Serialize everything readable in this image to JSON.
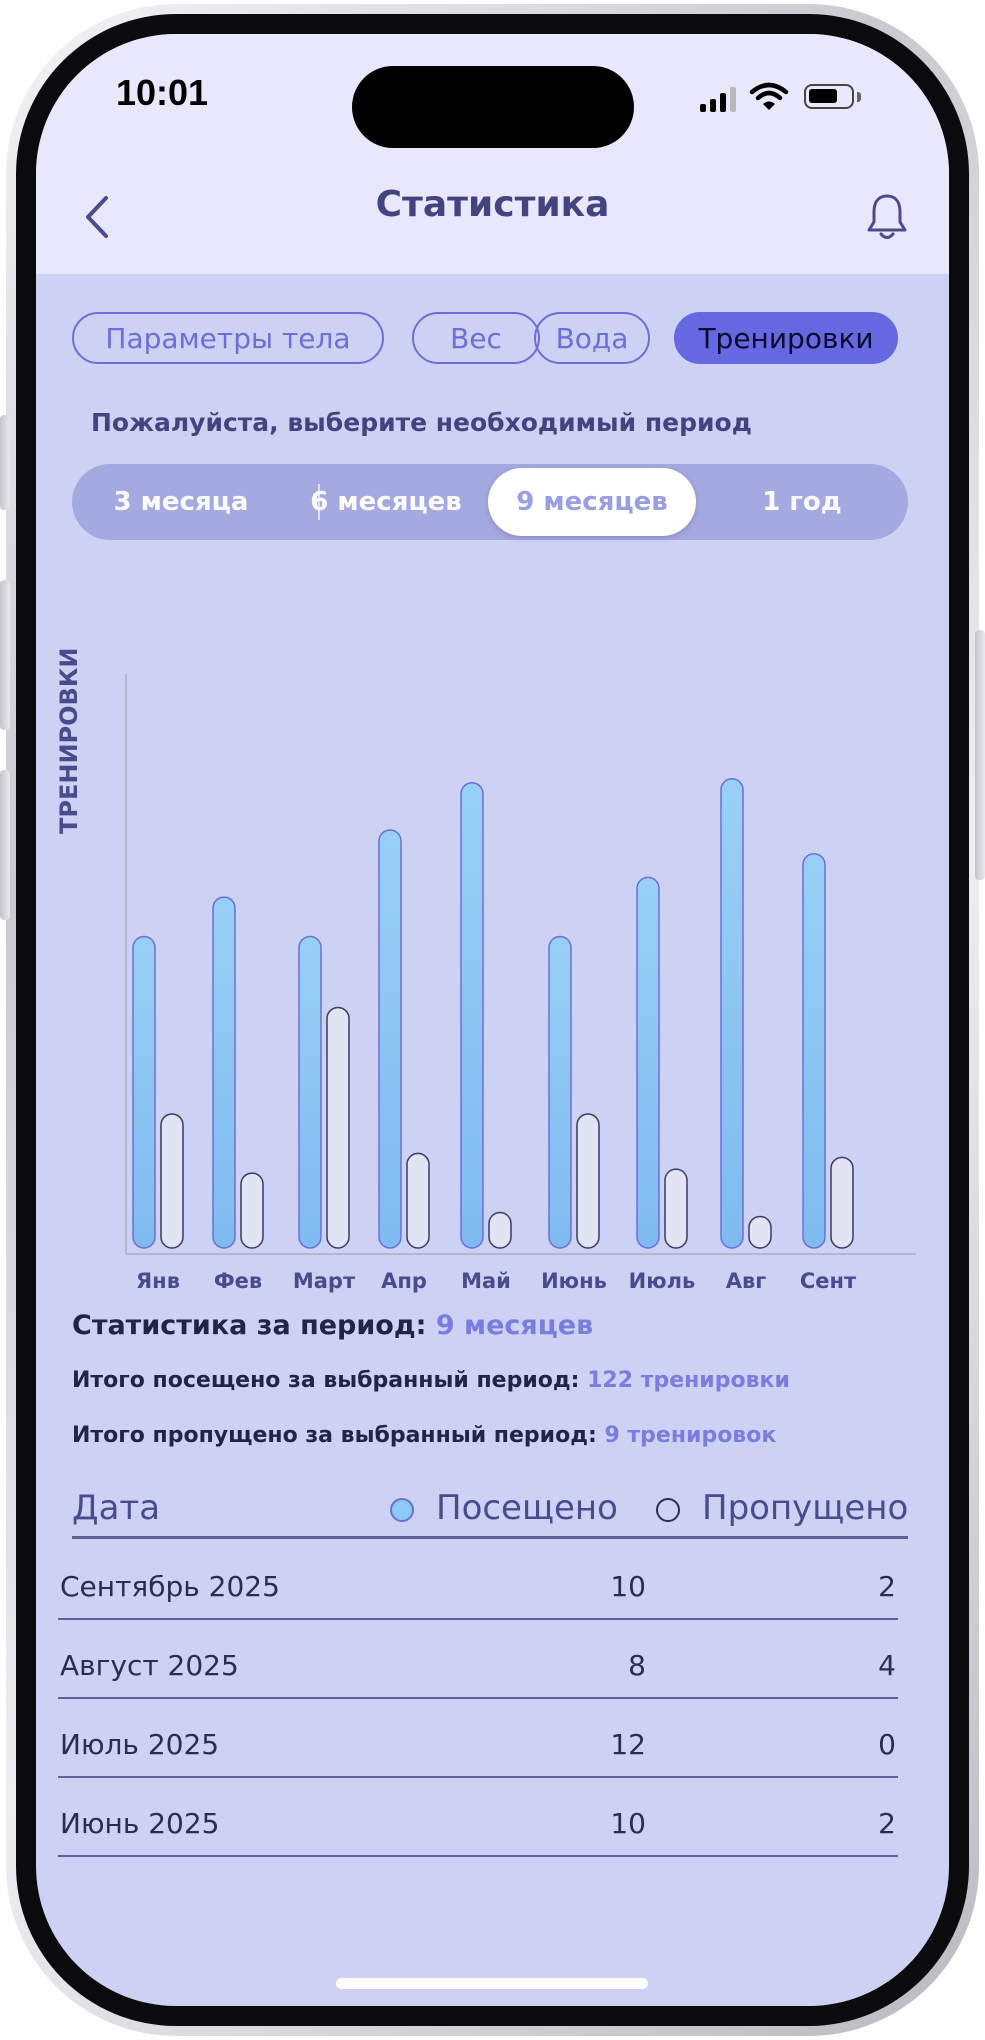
{
  "status_bar": {
    "time": "10:01"
  },
  "header": {
    "title": "Статистика"
  },
  "tabs": [
    {
      "label": "Параметры тела",
      "active": false
    },
    {
      "label": "Вес",
      "active": false
    },
    {
      "label": "Вода",
      "active": false
    },
    {
      "label": "Тренировки",
      "active": true
    }
  ],
  "period_prompt": "Пожалуйста, выберите необходимый период",
  "periods": [
    {
      "label": "3 месяца",
      "active": false
    },
    {
      "label": "6 месяцев",
      "active": false
    },
    {
      "label": "9 месяцев",
      "active": true
    },
    {
      "label": "1 год",
      "active": false
    }
  ],
  "chart_data": {
    "type": "bar",
    "ylabel": "ТРЕНИРОВКИ",
    "categories": [
      "Янв",
      "Фев",
      "Март",
      "Апр",
      "Май",
      "Июнь",
      "Июль",
      "Авг",
      "Сент"
    ],
    "series": [
      {
        "name": "Посещено",
        "values": [
          7.9,
          8.9,
          7.9,
          10.6,
          11.8,
          7.9,
          9.4,
          11.9,
          10.0
        ],
        "color": "#8cc9f4"
      },
      {
        "name": "Пропущено",
        "values": [
          3.4,
          1.9,
          6.1,
          2.4,
          0.9,
          3.4,
          2.0,
          0.8,
          2.3
        ],
        "color": "#e2e3f3"
      }
    ],
    "ylim": [
      0,
      14
    ],
    "grid": false,
    "legend": "none"
  },
  "stats": {
    "period_label": "Статистика за период:",
    "period_value": "9 месяцев",
    "visited_label": "Итого посещено за выбранный период:",
    "visited_value": "122 тренировки",
    "missed_label": "Итого пропущено за выбранный период:",
    "missed_value": "9 тренировок"
  },
  "table": {
    "col_date": "Дата",
    "col_visited": "Посещено",
    "col_missed": "Пропущено",
    "rows": [
      {
        "date": "Сентябрь 2025",
        "visited": "10",
        "missed": "2"
      },
      {
        "date": "Август 2025",
        "visited": "8",
        "missed": "4"
      },
      {
        "date": "Июль 2025",
        "visited": "12",
        "missed": "0"
      },
      {
        "date": "Июнь 2025",
        "visited": "10",
        "missed": "2"
      }
    ]
  },
  "colors": {
    "accent": "#6568e0",
    "background": "#cdd2f4",
    "header_background": "#e8e7fc",
    "title": "#42437f",
    "highlight": "#7a7dde"
  }
}
